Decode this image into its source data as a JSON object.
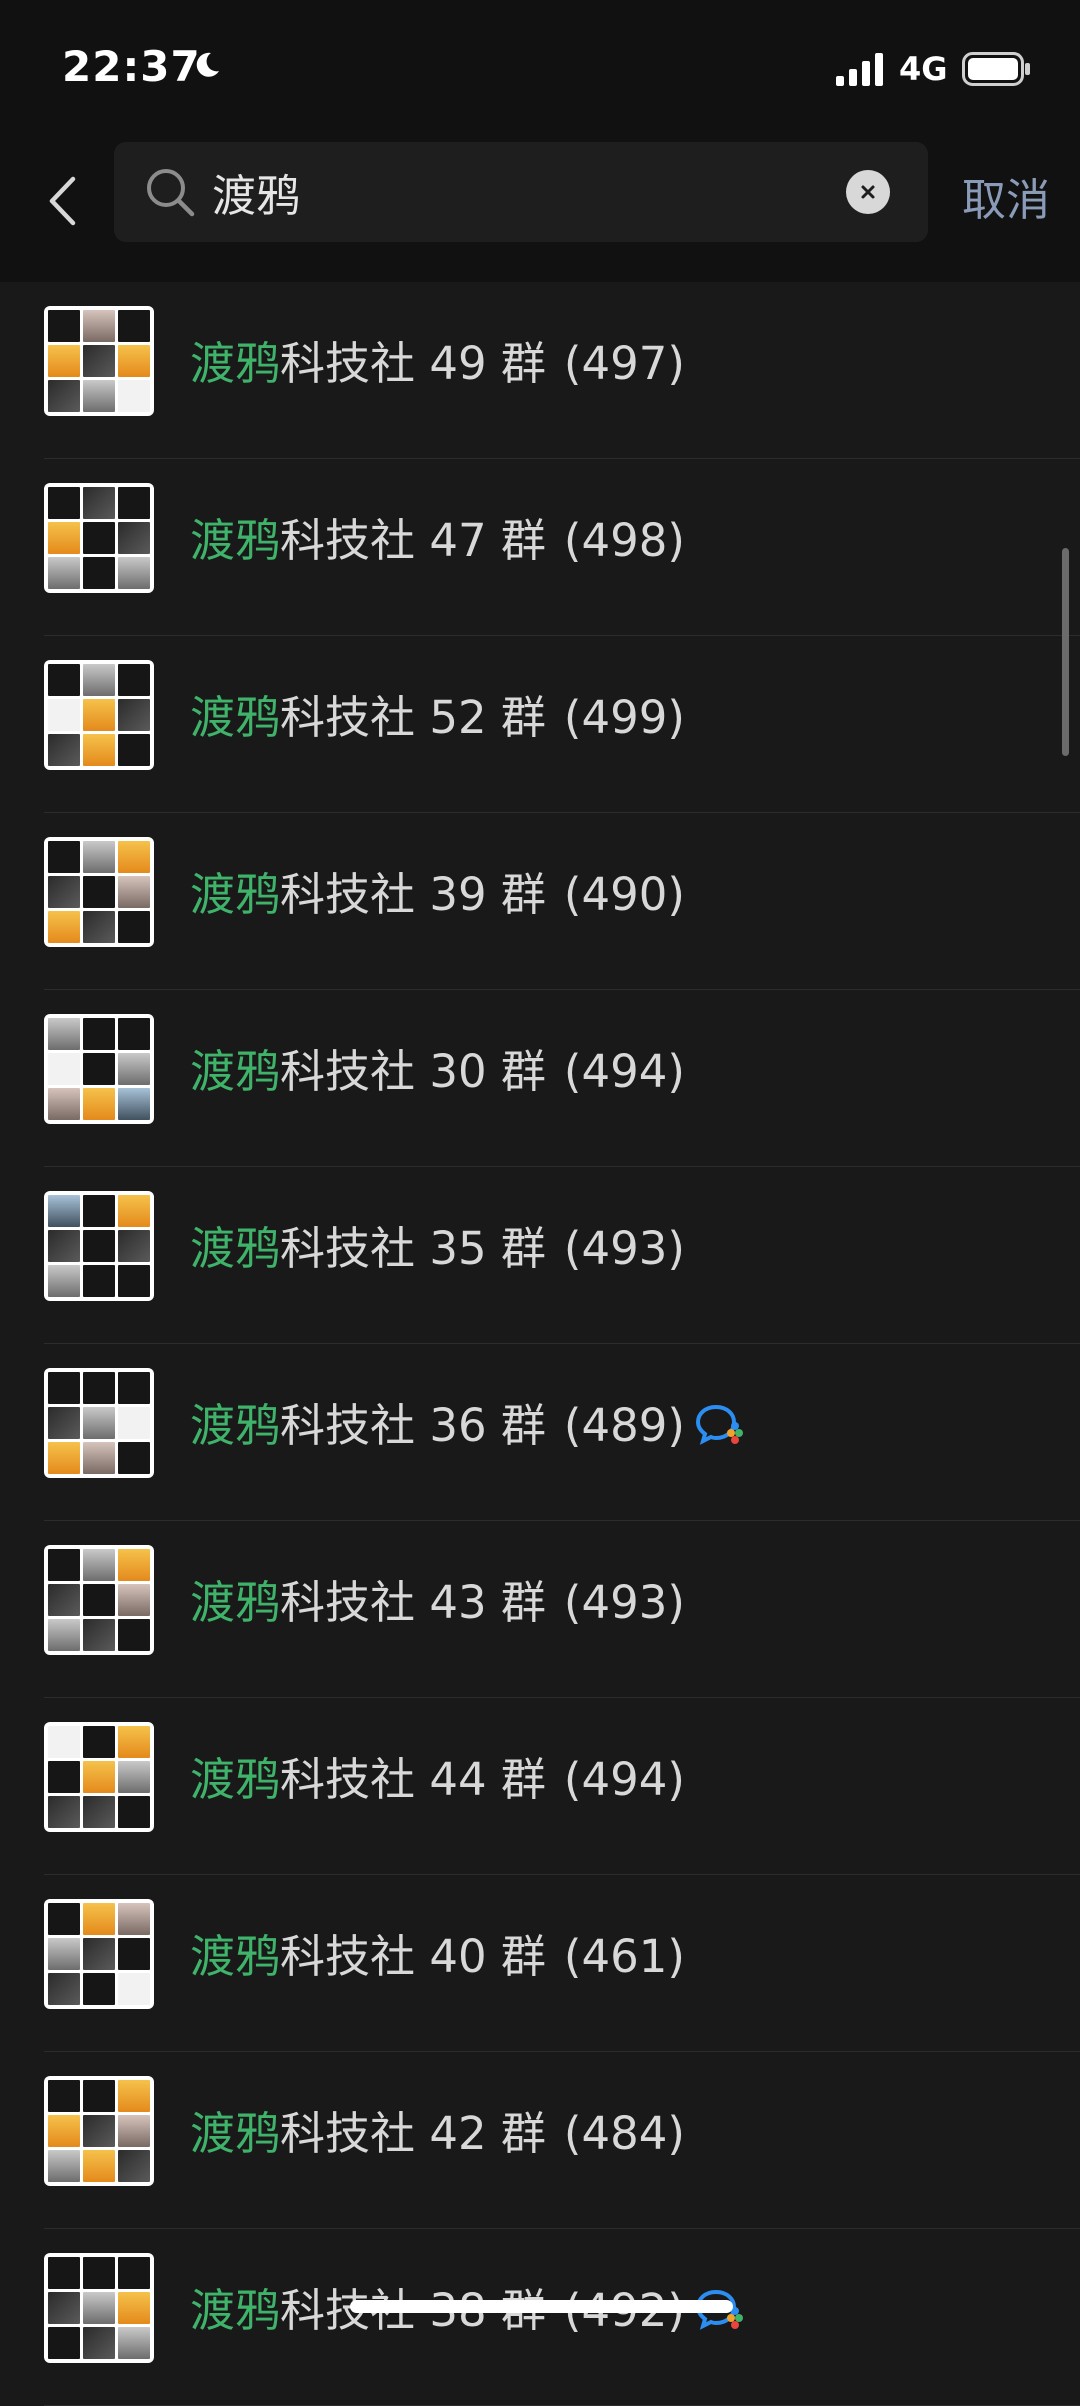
{
  "status_bar": {
    "time": "22:37",
    "network": "4G",
    "icons": [
      "moon-icon",
      "signal-icon",
      "battery-icon"
    ]
  },
  "search": {
    "query": "渡鸦",
    "icons": [
      "back-icon",
      "search-icon",
      "clear-icon"
    ],
    "cancel_label": "取消"
  },
  "colors": {
    "background": "#191919",
    "highlight": "#3fb36a",
    "text": "#d8d8d8",
    "cancel": "#8a9bb8"
  },
  "results": [
    {
      "highlight": "渡鸦",
      "rest": "科技社 49 群",
      "count": "(497)"
    },
    {
      "highlight": "渡鸦",
      "rest": "科技社 47 群",
      "count": "(498)"
    },
    {
      "highlight": "渡鸦",
      "rest": "科技社 52 群",
      "count": "(499)"
    },
    {
      "highlight": "渡鸦",
      "rest": "科技社 39 群",
      "count": "(490)"
    },
    {
      "highlight": "渡鸦",
      "rest": "科技社 30 群",
      "count": "(494)"
    },
    {
      "highlight": "渡鸦",
      "rest": "科技社 35 群",
      "count": "(493)"
    },
    {
      "highlight": "渡鸦",
      "rest": "科技社 36 群",
      "count": "(489)",
      "badge": "enterprise-chat-icon"
    },
    {
      "highlight": "渡鸦",
      "rest": "科技社 43 群",
      "count": "(493)"
    },
    {
      "highlight": "渡鸦",
      "rest": "科技社 44 群",
      "count": "(494)"
    },
    {
      "highlight": "渡鸦",
      "rest": "科技社 40 群",
      "count": "(461)"
    },
    {
      "highlight": "渡鸦",
      "rest": "科技社 42 群",
      "count": "(484)"
    },
    {
      "highlight": "渡鸦",
      "rest": "科技社 38 群",
      "count": "(492)",
      "badge": "enterprise-chat-icon"
    }
  ]
}
